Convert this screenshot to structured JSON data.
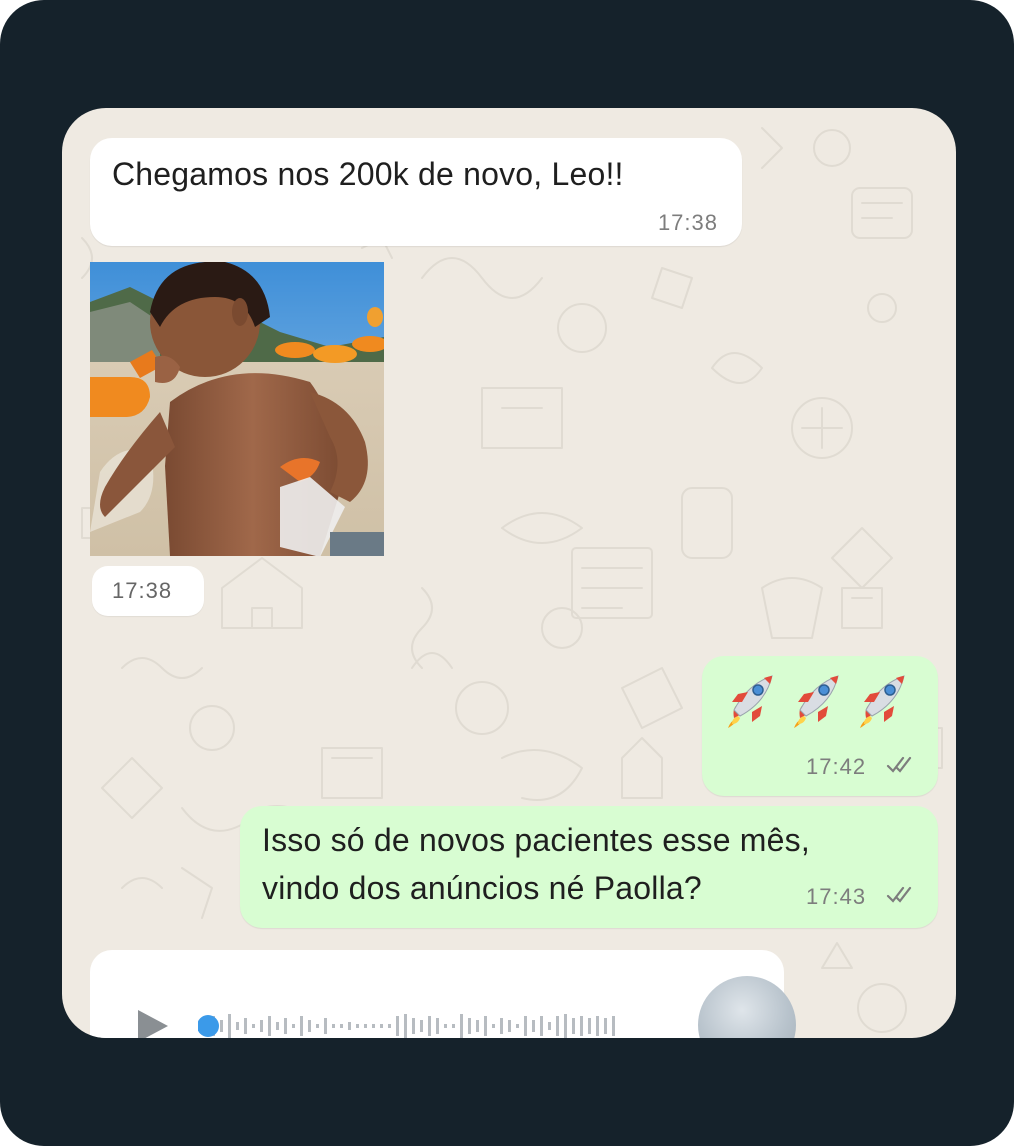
{
  "colors": {
    "frame": "#15222b",
    "wallpaper": "#efeae2",
    "incoming_bubble": "#ffffff",
    "outgoing_bubble": "#d8fdd2",
    "read_ticks": "#7d7d7d",
    "audio_accent": "#3b9ae9"
  },
  "messages": [
    {
      "direction": "incoming",
      "type": "text",
      "text": "Chegamos nos 200k de novo, Leo!!",
      "time": "17:38"
    },
    {
      "direction": "incoming",
      "type": "image",
      "time": "17:38"
    },
    {
      "direction": "outgoing",
      "type": "emoji",
      "emoji": "🚀🚀🚀",
      "time": "17:42",
      "status": "read"
    },
    {
      "direction": "outgoing",
      "type": "text",
      "lines": [
        "Isso só de novos pacientes esse mês,",
        "vindo dos anúncios né Paolla?"
      ],
      "time": "17:43",
      "status": "read"
    },
    {
      "direction": "incoming",
      "type": "audio",
      "icon": "play-icon"
    }
  ]
}
